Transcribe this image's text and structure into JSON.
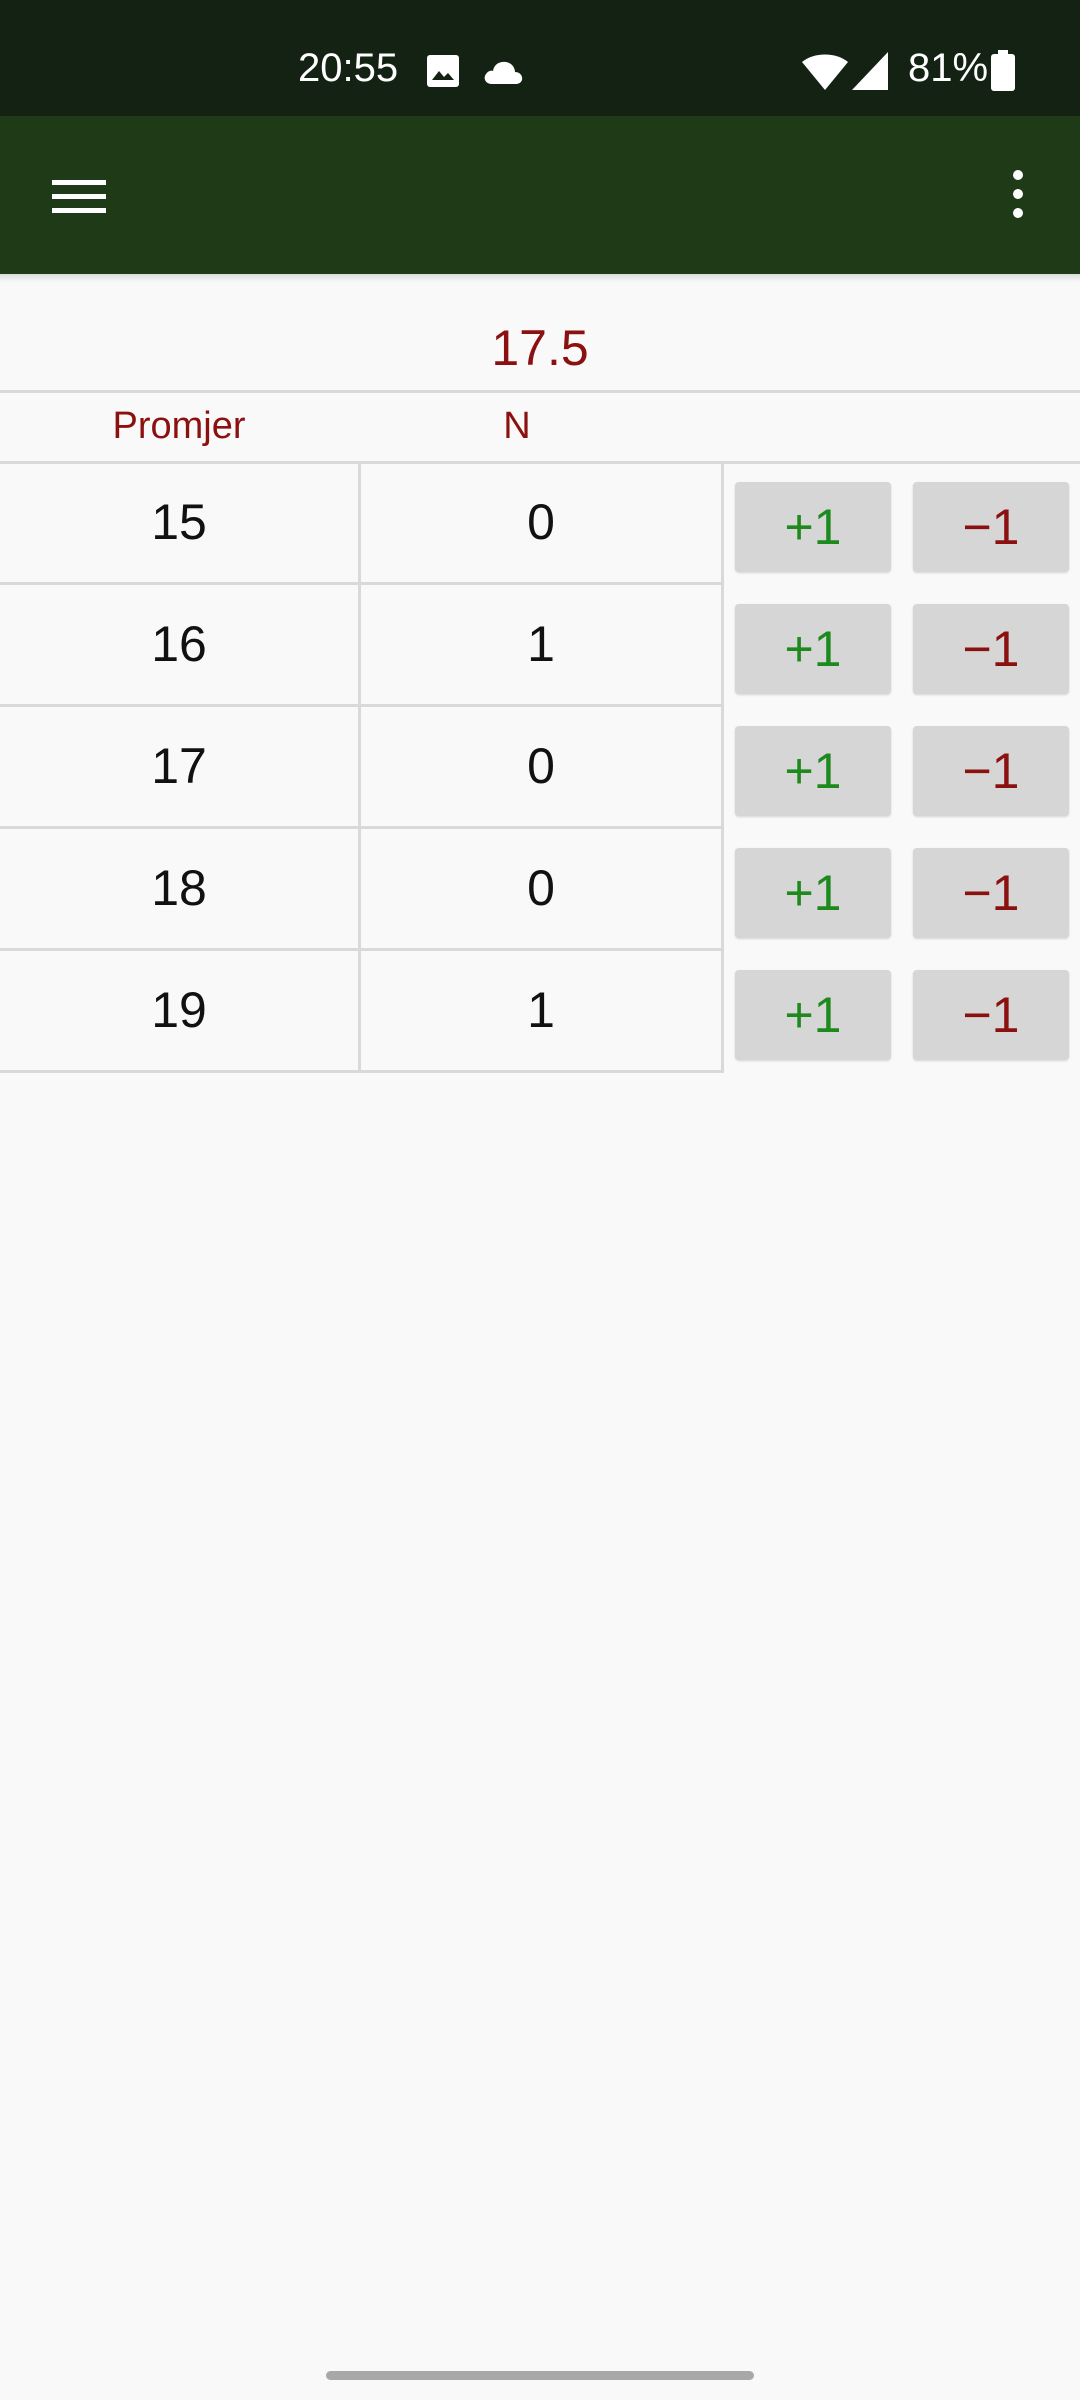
{
  "status_bar": {
    "time": "20:55",
    "battery": "81%",
    "icons": [
      "image-icon",
      "cloud-icon",
      "wifi-icon",
      "signal-icon",
      "battery-icon"
    ]
  },
  "app_bar": {
    "menu_icon": "hamburger-menu-icon",
    "overflow_icon": "more-vert-icon",
    "background": "#1f3a16"
  },
  "summary": {
    "mean": "17.5"
  },
  "table": {
    "headers": {
      "size": "Promjer",
      "count": "N"
    },
    "rows": [
      {
        "size": "15",
        "count": "0"
      },
      {
        "size": "16",
        "count": "1"
      },
      {
        "size": "17",
        "count": "0"
      },
      {
        "size": "18",
        "count": "0"
      },
      {
        "size": "19",
        "count": "1"
      }
    ]
  },
  "buttons": {
    "increment_label": "+1",
    "decrement_label": "−1"
  },
  "colors": {
    "accent_red": "#8b1010",
    "accent_green": "#1e8a1e",
    "status_bar": "#142214"
  }
}
